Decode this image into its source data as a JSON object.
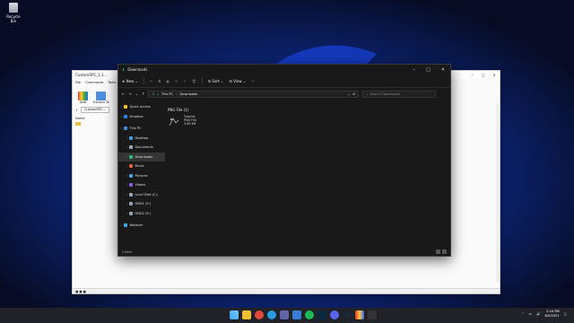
{
  "desktop": {
    "recycle_bin_label": "Recycle Bin"
  },
  "back_window": {
    "title": "CustomRPC_1.1...",
    "menu": [
      "File",
      "Commands",
      "Tools"
    ],
    "ribbon": [
      "Add",
      "Extract To"
    ],
    "address": "CustomRPC...",
    "column_name": "Name",
    "status": "■ ■ ■"
  },
  "explorer": {
    "title": "Downloads",
    "toolbar": {
      "new": "New",
      "sort": "Sort",
      "view": "View",
      "more": "···"
    },
    "breadcrumb": [
      "This PC",
      "Downloads"
    ],
    "search_placeholder": "Search Downloads",
    "sidebar": [
      {
        "label": "Quick access",
        "color": "#f5c518",
        "level": 0
      },
      {
        "label": "Dropbox",
        "color": "#2f7ff0",
        "level": 0
      },
      {
        "label": "This PC",
        "color": "#3b8ede",
        "level": 0
      },
      {
        "label": "Desktop",
        "color": "#39a0e8",
        "level": 1
      },
      {
        "label": "Documents",
        "color": "#9aa4b0",
        "level": 1
      },
      {
        "label": "Downloads",
        "color": "#35b574",
        "level": 1,
        "selected": true
      },
      {
        "label": "Music",
        "color": "#e85c3a",
        "level": 1
      },
      {
        "label": "Pictures",
        "color": "#4aa3e3",
        "level": 1
      },
      {
        "label": "Videos",
        "color": "#8a5ae0",
        "level": 1
      },
      {
        "label": "Local Disk (C:)",
        "color": "#9aa4b0",
        "level": 1
      },
      {
        "label": "HDD1 (E:)",
        "color": "#9aa4b0",
        "level": 1
      },
      {
        "label": "HDD2 (E:)",
        "color": "#9aa4b0",
        "level": 1
      },
      {
        "label": "Network",
        "color": "#4aa3e3",
        "level": 0
      }
    ],
    "group_header": "PNG File (1)",
    "file": {
      "name": "Tutorial",
      "type": "PNG File",
      "size": "3.89 KB"
    },
    "status": "1 item"
  },
  "taskbar": {
    "time": "2:24 PM",
    "date": "8/5/2021"
  }
}
